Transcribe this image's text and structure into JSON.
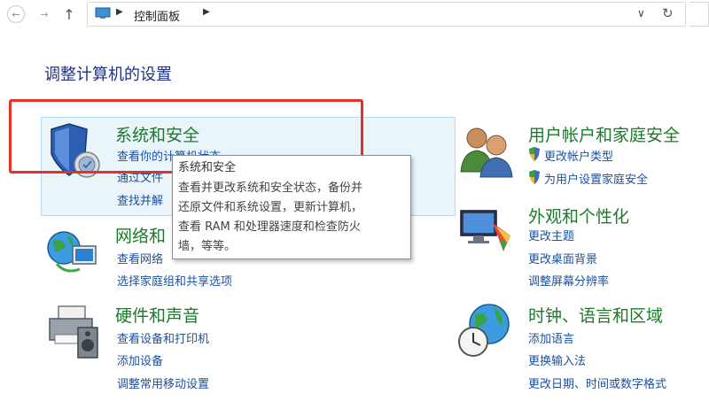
{
  "address_bar": {
    "back_icon": "back-arrow-icon",
    "forward_icon": "forward-arrow-icon",
    "up_icon": "up-arrow-icon",
    "crumb": "控制面板",
    "dropdown_glyph": "∨",
    "refresh_glyph": "↻"
  },
  "heading": "调整计算机的设置",
  "categories": {
    "system": {
      "title": "系统和安全",
      "links": [
        "查看你的计算机状态",
        "通过文件",
        "查找并解"
      ]
    },
    "network": {
      "title": "网络和",
      "links": [
        "查看网络",
        "选择家庭组和共享选项"
      ]
    },
    "hardware": {
      "title": "硬件和声音",
      "links": [
        "查看设备和打印机",
        "添加设备",
        "调整常用移动设置"
      ]
    },
    "user": {
      "title": "用户帐户和家庭安全",
      "links": [
        "更改帐户类型",
        "为用户设置家庭安全"
      ]
    },
    "appearance": {
      "title": "外观和个性化",
      "links": [
        "更改主题",
        "更改桌面背景",
        "调整屏幕分辨率"
      ]
    },
    "clock": {
      "title": "时钟、语言和区域",
      "links": [
        "添加语言",
        "更换输入法",
        "更改日期、时间或数字格式"
      ]
    }
  },
  "tooltip": {
    "title": "系统和安全",
    "lines": [
      "查看并更改系统和安全状态，备份并",
      "还原文件和系统设置，更新计算机，",
      "查看 RAM 和处理器速度和检查防火",
      "墙，等等。"
    ]
  },
  "colors": {
    "category_title": "#1c7a2a",
    "link": "#1d4f9c",
    "heading": "#1e3287",
    "highlight_bg": "#e9f5fb",
    "annotation_frame": "#e5312a"
  }
}
